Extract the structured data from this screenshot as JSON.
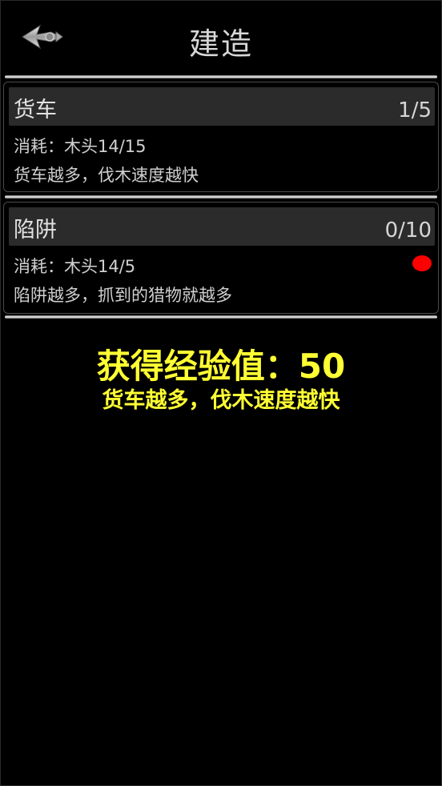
{
  "header": {
    "title": "建造",
    "back_icon": "back-arrow-icon"
  },
  "build_items": [
    {
      "name": "货车",
      "count": "1/5",
      "cost": "消耗：木头14/15",
      "desc": "货车越多，伐木速度越快",
      "alert": false
    },
    {
      "name": "陷阱",
      "count": "0/10",
      "cost": "消耗：木头14/5",
      "desc": "陷阱越多，抓到的猎物就越多",
      "alert": true
    }
  ],
  "reward": {
    "title": "获得经验值：50",
    "subtitle": "货车越多，伐木速度越快"
  },
  "colors": {
    "background": "#000000",
    "reward_text": "#ffff33",
    "alert_dot": "#ff0000",
    "card_header": "#2b2b2b"
  }
}
